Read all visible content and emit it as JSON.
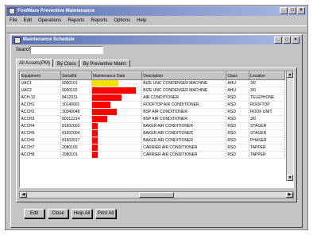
{
  "app": {
    "title": "FindWare Preventive Maintenance",
    "menu": [
      "File",
      "Edit",
      "Operations",
      "Reports",
      "Reports",
      "Options",
      "Help"
    ]
  },
  "window_buttons": [
    "_",
    "□",
    "×"
  ],
  "child": {
    "title": "Maintenance Schedule",
    "search_label": "Search",
    "search_value": "",
    "tabs": [
      "All Assets(PM)",
      "By Class",
      "By Preventive Maint."
    ],
    "columns": [
      "Equipment",
      "Serial/Id",
      "Maintenance Date",
      "Description",
      "Class",
      "Location"
    ],
    "rows": [
      {
        "equipment": "UAC1",
        "serial": "5000101",
        "level": 0.55,
        "color": "#f4e000",
        "description": "BIZE UNC CONDENSER MACHINE",
        "class": "AHU",
        "location": "3/0"
      },
      {
        "equipment": "UAC2",
        "serial": "5000102",
        "level": 0.92,
        "color": "#ff0000",
        "description": "BIZE UNC CONDENSER MACHINE",
        "class": "AHU",
        "location": "3/0"
      },
      {
        "equipment": "ACH-12",
        "serial": "8412031",
        "level": 0.62,
        "color": "#ff0000",
        "description": "AIR CONDITIONER",
        "class": "RSD",
        "location": "TELEPHONE"
      },
      {
        "equipment": "ACCH1",
        "serial": "30140001",
        "level": 0.38,
        "color": "#ff0000",
        "description": "ROOFTOP AIR CONDITIONER",
        "class": "RSD",
        "location": "ROOFTOP"
      },
      {
        "equipment": "ACCH2",
        "serial": "30340048",
        "level": 0.52,
        "color": "#ff0000",
        "description": "BSP AIR CONDITIONER",
        "class": "RSD",
        "location": "ROOF UNIT"
      },
      {
        "equipment": "ACCH3",
        "serial": "80312214",
        "level": 0.32,
        "color": "#ff0000",
        "description": "BSP AIR CONDITIONER",
        "class": "RSD",
        "location": "3/0"
      },
      {
        "equipment": "ACCH4",
        "serial": "81602003",
        "level": 0.12,
        "color": "#ff0000",
        "description": "BAKER AIR CONDITIONER",
        "class": "RSD",
        "location": "STAGER"
      },
      {
        "equipment": "ACCH5",
        "serial": "81602004",
        "level": 0.12,
        "color": "#ff0000",
        "description": "BAKER AIR CONDITIONER",
        "class": "RSD",
        "location": "STAGER"
      },
      {
        "equipment": "ACCH6",
        "serial": "81602017",
        "level": 0.12,
        "color": "#ff0000",
        "description": "BAKER AIR CONDITIONER",
        "class": "RSD",
        "location": "PHASER"
      },
      {
        "equipment": "ACCH7",
        "serial": "2080100",
        "level": 0.12,
        "color": "#ff0000",
        "description": "CARRIER AIR CONDITIONER",
        "class": "RSD",
        "location": "TAPPER"
      },
      {
        "equipment": "ACCH8",
        "serial": "2080101",
        "level": 0.12,
        "color": "#ff0000",
        "description": "CARRIER AIR CONDITIONER",
        "class": "RSD",
        "location": "TAPPER"
      }
    ],
    "buttons": [
      "Edit",
      "Close",
      "Help All",
      "Print All"
    ]
  }
}
